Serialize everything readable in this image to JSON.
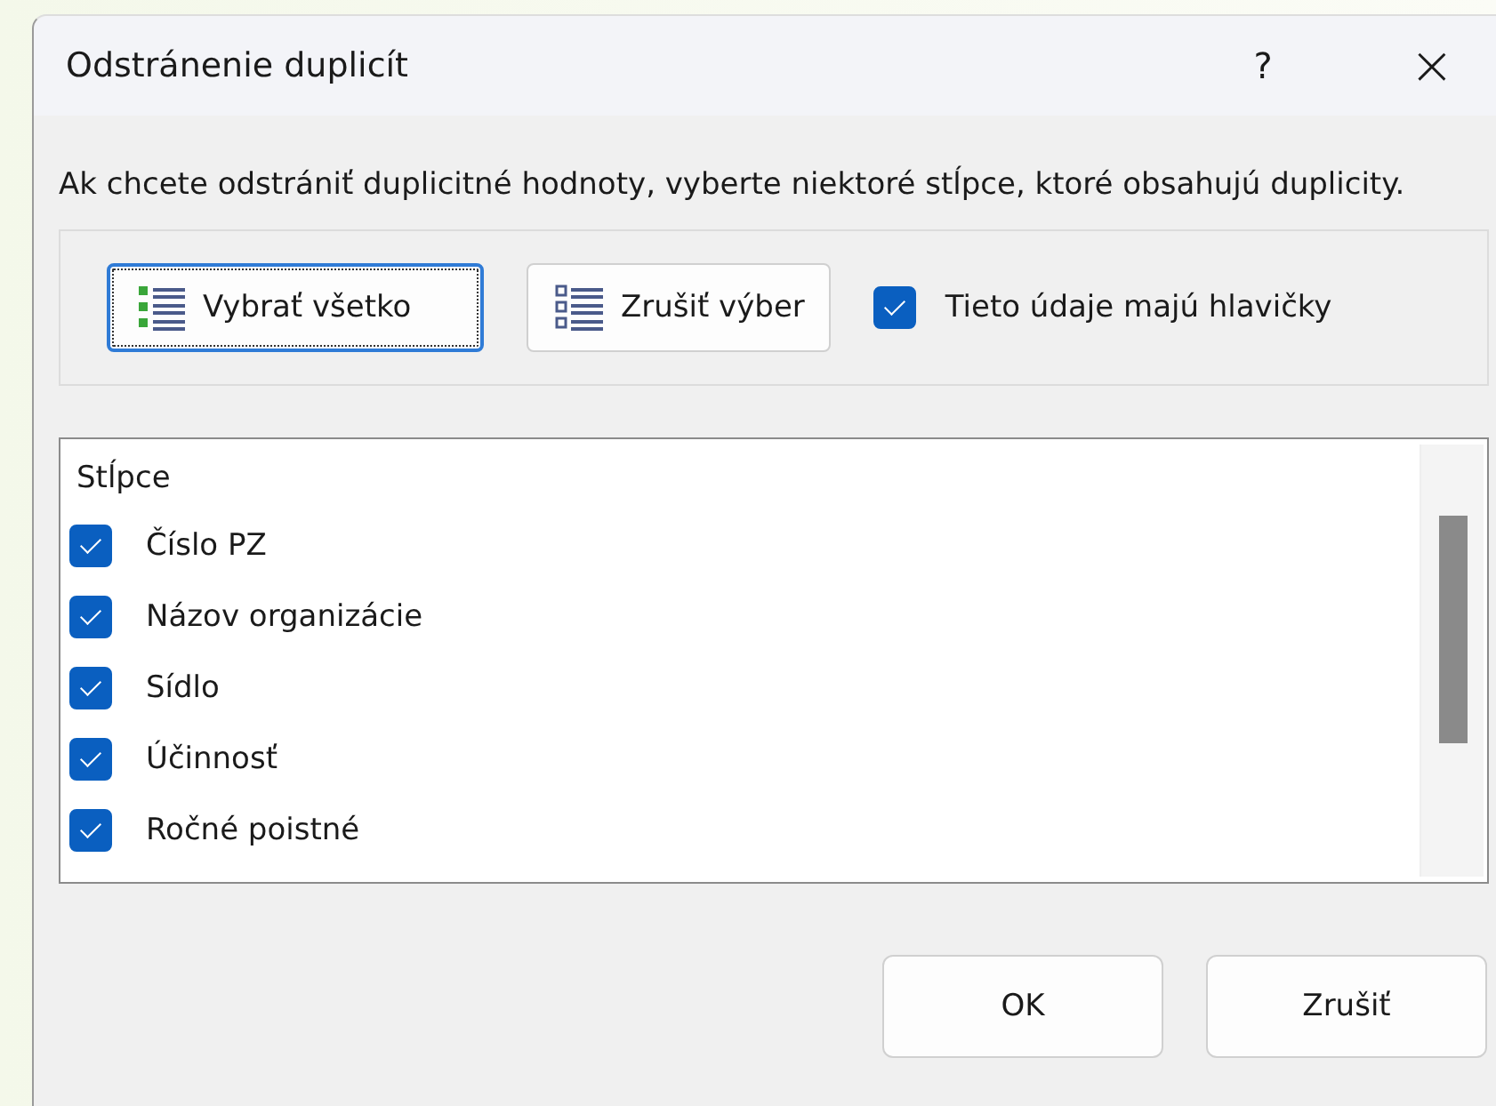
{
  "window": {
    "title": "Odstránenie duplicít",
    "help": "?",
    "close": "×"
  },
  "description": "Ak chcete odstrániť duplicitné hodnoty, vyberte niektoré stĺpce, ktoré obsahujú duplicity.",
  "toolbar": {
    "select_all": "Vybrať všetko",
    "unselect_all": "Zrušiť výber",
    "headers": {
      "label": "Tieto údaje majú hlavičky",
      "checked": true
    }
  },
  "columns": {
    "header": "Stĺpce",
    "items": [
      {
        "label": "Číslo PZ",
        "checked": true
      },
      {
        "label": "Názov organizácie",
        "checked": true
      },
      {
        "label": "Sídlo",
        "checked": true
      },
      {
        "label": "Účinnosť",
        "checked": true
      },
      {
        "label": "Ročné poistné",
        "checked": true
      }
    ]
  },
  "buttons": [
    "OK",
    "Zrušiť"
  ]
}
